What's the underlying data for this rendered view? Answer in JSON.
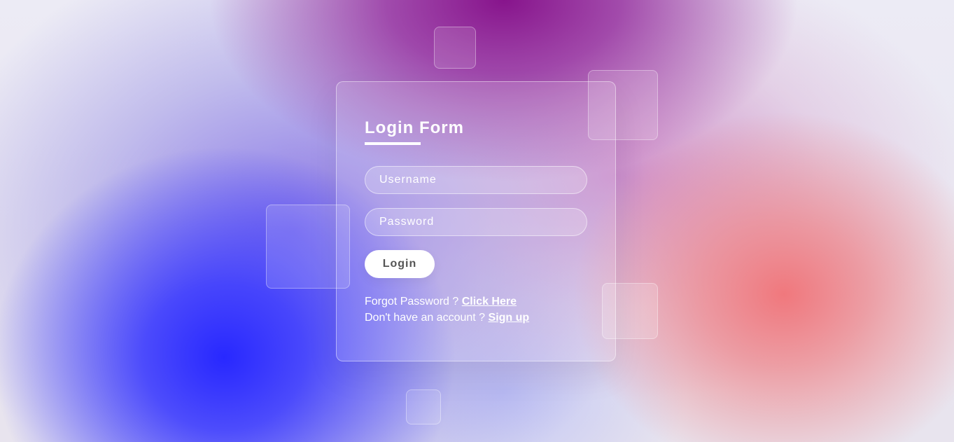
{
  "form": {
    "title": "Login Form",
    "username_placeholder": "Username",
    "password_placeholder": "Password",
    "login_label": "Login",
    "forgot_text": "Forgot Password ?",
    "forgot_link": "Click Here",
    "signup_text": "Don't have an account ?",
    "signup_link": "Sign up"
  },
  "colors": {
    "blue_glow": "#3333ff",
    "purple_glow": "#8a1c8e",
    "coral_glow": "#f07c80",
    "button_bg": "#ffffff",
    "button_text": "#555555"
  }
}
